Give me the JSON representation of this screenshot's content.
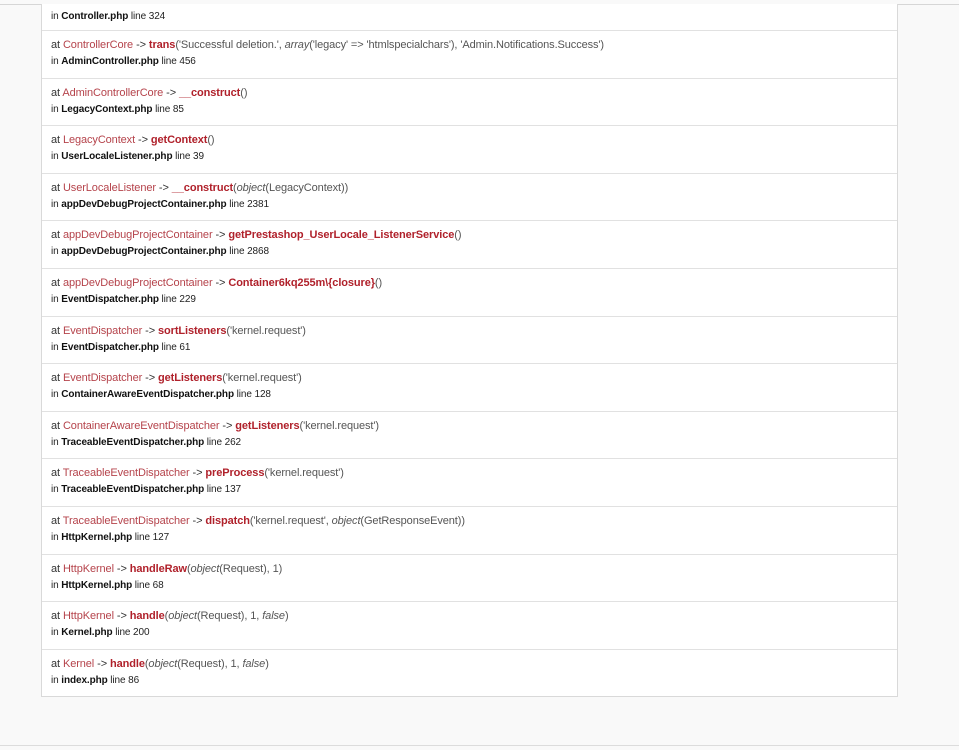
{
  "trace": {
    "first_frame": {
      "file": "Controller.php",
      "line": "line 324"
    },
    "frames": [
      {
        "at": "at",
        "class": "ControllerCore",
        "arrow": "->",
        "method": "trans",
        "args_open": "(",
        "args": [
          {
            "text": "'Successful deletion.', ",
            "italic": false
          },
          {
            "text": "array",
            "italic": true
          },
          {
            "text": "('legacy' => 'htmlspecialchars'), 'Admin.Notifications.Success'",
            "italic": false
          }
        ],
        "args_close": ")",
        "file": "AdminController.php",
        "line": "line 456"
      },
      {
        "at": "at",
        "class": "AdminControllerCore",
        "arrow": "->",
        "method": "__construct",
        "args_open": "(",
        "args": [],
        "args_close": ")",
        "file": "LegacyContext.php",
        "line": "line 85"
      },
      {
        "at": "at",
        "class": "LegacyContext",
        "arrow": "->",
        "method": "getContext",
        "args_open": "(",
        "args": [],
        "args_close": ")",
        "file": "UserLocaleListener.php",
        "line": "line 39"
      },
      {
        "at": "at",
        "class": "UserLocaleListener",
        "arrow": "->",
        "method": "__construct",
        "args_open": "(",
        "args": [
          {
            "text": "object",
            "italic": true
          },
          {
            "text": "(LegacyContext)",
            "italic": false
          }
        ],
        "args_close": ")",
        "file": "appDevDebugProjectContainer.php",
        "line": "line 2381"
      },
      {
        "at": "at",
        "class": "appDevDebugProjectContainer",
        "arrow": "->",
        "method": "getPrestashop_UserLocale_ListenerService",
        "args_open": "(",
        "args": [],
        "args_close": ")",
        "file": "appDevDebugProjectContainer.php",
        "line": "line 2868"
      },
      {
        "at": "at",
        "class": "appDevDebugProjectContainer",
        "arrow": "->",
        "method": "Container6kq255m\\{closure}",
        "args_open": "(",
        "args": [],
        "args_close": ")",
        "file": "EventDispatcher.php",
        "line": "line 229"
      },
      {
        "at": "at",
        "class": "EventDispatcher",
        "arrow": "->",
        "method": "sortListeners",
        "args_open": "(",
        "args": [
          {
            "text": "'kernel.request'",
            "italic": false
          }
        ],
        "args_close": ")",
        "file": "EventDispatcher.php",
        "line": "line 61"
      },
      {
        "at": "at",
        "class": "EventDispatcher",
        "arrow": "->",
        "method": "getListeners",
        "args_open": "(",
        "args": [
          {
            "text": "'kernel.request'",
            "italic": false
          }
        ],
        "args_close": ")",
        "file": "ContainerAwareEventDispatcher.php",
        "line": "line 128"
      },
      {
        "at": "at",
        "class": "ContainerAwareEventDispatcher",
        "arrow": "->",
        "method": "getListeners",
        "args_open": "(",
        "args": [
          {
            "text": "'kernel.request'",
            "italic": false
          }
        ],
        "args_close": ")",
        "file": "TraceableEventDispatcher.php",
        "line": "line 262"
      },
      {
        "at": "at",
        "class": "TraceableEventDispatcher",
        "arrow": "->",
        "method": "preProcess",
        "args_open": "(",
        "args": [
          {
            "text": "'kernel.request'",
            "italic": false
          }
        ],
        "args_close": ")",
        "file": "TraceableEventDispatcher.php",
        "line": "line 137"
      },
      {
        "at": "at",
        "class": "TraceableEventDispatcher",
        "arrow": "->",
        "method": "dispatch",
        "args_open": "(",
        "args": [
          {
            "text": "'kernel.request', ",
            "italic": false
          },
          {
            "text": "object",
            "italic": true
          },
          {
            "text": "(GetResponseEvent)",
            "italic": false
          }
        ],
        "args_close": ")",
        "file": "HttpKernel.php",
        "line": "line 127"
      },
      {
        "at": "at",
        "class": "HttpKernel",
        "arrow": "->",
        "method": "handleRaw",
        "args_open": "(",
        "args": [
          {
            "text": "object",
            "italic": true
          },
          {
            "text": "(Request), 1",
            "italic": false
          }
        ],
        "args_close": ")",
        "file": "HttpKernel.php",
        "line": "line 68"
      },
      {
        "at": "at",
        "class": "HttpKernel",
        "arrow": "->",
        "method": "handle",
        "args_open": "(",
        "args": [
          {
            "text": "object",
            "italic": true
          },
          {
            "text": "(Request), 1, ",
            "italic": false
          },
          {
            "text": "false",
            "italic": true
          }
        ],
        "args_close": ")",
        "file": "Kernel.php",
        "line": "line 200"
      },
      {
        "at": "at",
        "class": "Kernel",
        "arrow": "->",
        "method": "handle",
        "args_open": "(",
        "args": [
          {
            "text": "object",
            "italic": true
          },
          {
            "text": "(Request), 1, ",
            "italic": false
          },
          {
            "text": "false",
            "italic": true
          }
        ],
        "args_close": ")",
        "file": "index.php",
        "line": "line 86"
      }
    ],
    "in_label": "in"
  }
}
